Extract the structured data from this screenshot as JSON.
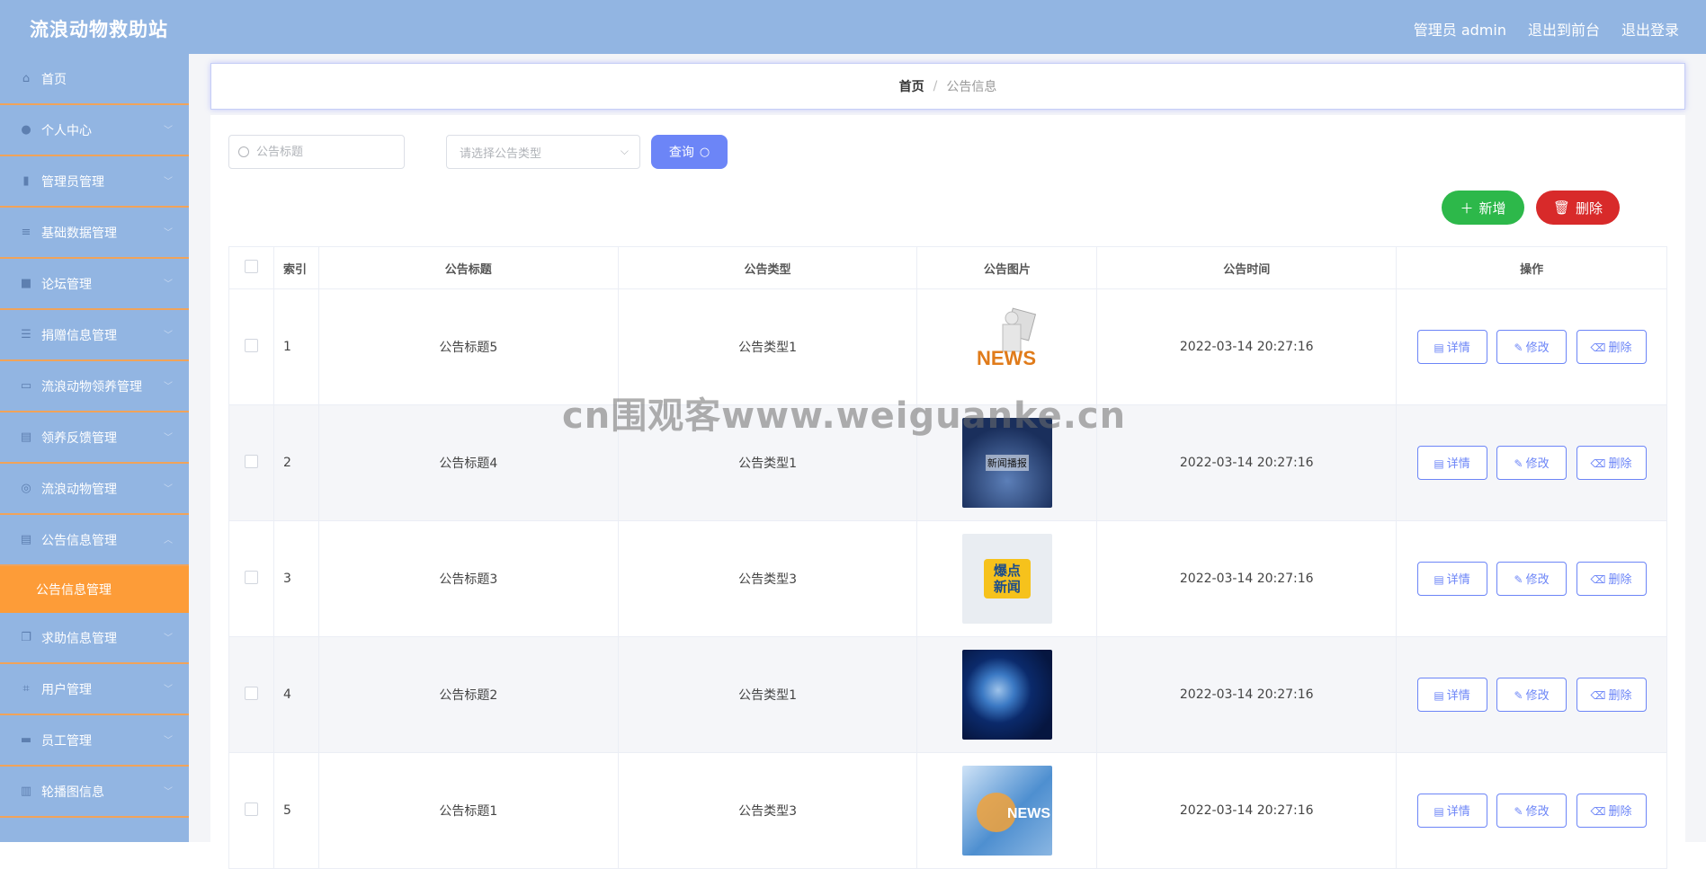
{
  "app": {
    "title": "流浪动物救助站"
  },
  "header": {
    "user": "管理员 admin",
    "to_front": "退出到前台",
    "logout": "退出登录"
  },
  "sidebar": {
    "items": [
      {
        "label": "首页",
        "icon": "home-icon",
        "expandable": false
      },
      {
        "label": "个人中心",
        "icon": "user-icon",
        "expandable": true
      },
      {
        "label": "管理员管理",
        "icon": "bar-chart-icon",
        "expandable": true
      },
      {
        "label": "基础数据管理",
        "icon": "list-icon",
        "expandable": true
      },
      {
        "label": "论坛管理",
        "icon": "briefcase-icon",
        "expandable": true
      },
      {
        "label": "捐赠信息管理",
        "icon": "sliders-icon",
        "expandable": true
      },
      {
        "label": "流浪动物领养管理",
        "icon": "card-icon",
        "expandable": true
      },
      {
        "label": "领养反馈管理",
        "icon": "clipboard-icon",
        "expandable": true
      },
      {
        "label": "流浪动物管理",
        "icon": "target-icon",
        "expandable": true
      },
      {
        "label": "公告信息管理",
        "icon": "clipboard-icon",
        "expandable": true
      }
    ],
    "active_sub": "公告信息管理",
    "items_after": [
      {
        "label": "求助信息管理",
        "icon": "copy-icon",
        "expandable": true
      },
      {
        "label": "用户管理",
        "icon": "crop-icon",
        "expandable": true
      },
      {
        "label": "员工管理",
        "icon": "chat-icon",
        "expandable": true
      },
      {
        "label": "轮播图信息",
        "icon": "columns-icon",
        "expandable": true
      }
    ]
  },
  "breadcrumb": {
    "home": "首页",
    "sep": "/",
    "current": "公告信息"
  },
  "search": {
    "title_placeholder": "公告标题",
    "type_placeholder": "请选择公告类型",
    "query_label": "查询"
  },
  "actions": {
    "add_label": "新增",
    "delete_label": "删除"
  },
  "table": {
    "headers": [
      "索引",
      "公告标题",
      "公告类型",
      "公告图片",
      "公告时间",
      "操作"
    ],
    "ops": {
      "detail": "详情",
      "edit": "修改",
      "delete": "删除"
    },
    "rows": [
      {
        "index": "1",
        "title": "公告标题5",
        "type": "公告类型1",
        "time": "2022-03-14 20:27:16",
        "image": "news-figure"
      },
      {
        "index": "2",
        "title": "公告标题4",
        "type": "公告类型1",
        "time": "2022-03-14 20:27:16",
        "image": "news-stage",
        "image_text": "新闻播报"
      },
      {
        "index": "3",
        "title": "公告标题3",
        "type": "公告类型3",
        "time": "2022-03-14 20:27:16",
        "image": "hot-news",
        "image_text": "爆点新闻"
      },
      {
        "index": "4",
        "title": "公告标题2",
        "type": "公告类型1",
        "time": "2022-03-14 20:27:16",
        "image": "globe"
      },
      {
        "index": "5",
        "title": "公告标题1",
        "type": "公告类型3",
        "time": "2022-03-14 20:27:16",
        "image": "news-blue"
      }
    ]
  },
  "watermark": "cn围观客www.weiguanke.cn",
  "colors": {
    "sidebar": "#92b5e2",
    "accent": "#fd9c38",
    "primary": "#6c85f7",
    "success": "#2db84a",
    "danger": "#d82a2a"
  }
}
